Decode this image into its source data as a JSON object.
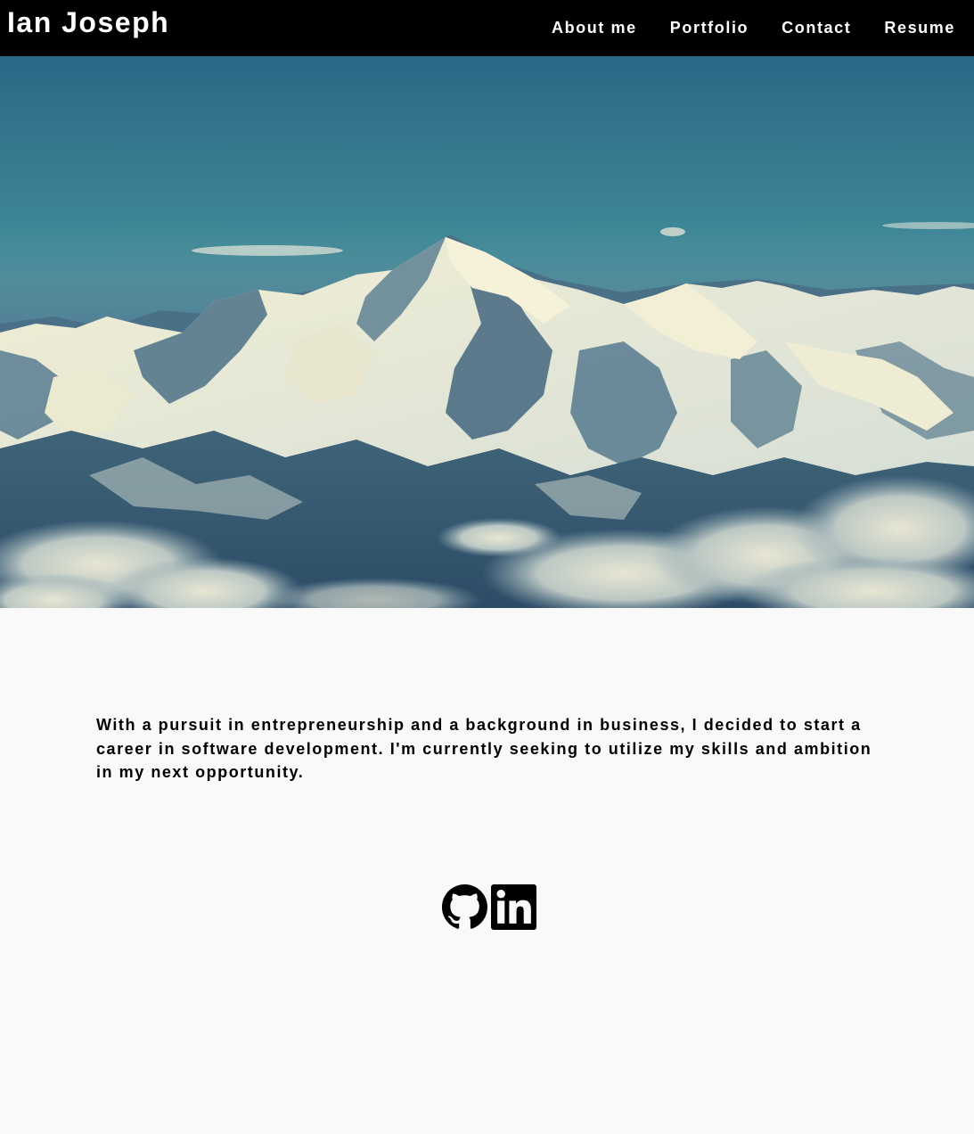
{
  "header": {
    "brand": "Ian Joseph",
    "nav": [
      {
        "label": "About me"
      },
      {
        "label": "Portfolio"
      },
      {
        "label": "Contact"
      },
      {
        "label": "Resume"
      }
    ]
  },
  "hero": {
    "image": "snowy-mountain-range-photo"
  },
  "main": {
    "bio": "With a pursuit in entrepreneurship and a background in business, I decided to start a career in software development. I'm currently seeking to utilize my skills and ambition in my next opportunity."
  },
  "social": {
    "icons": [
      "github-icon",
      "linkedin-icon"
    ]
  },
  "colors": {
    "header_bg": "#000000",
    "header_text": "#ffffff",
    "page_bg": "#f9f9f9",
    "body_text": "#000000",
    "icon": "#000000"
  }
}
